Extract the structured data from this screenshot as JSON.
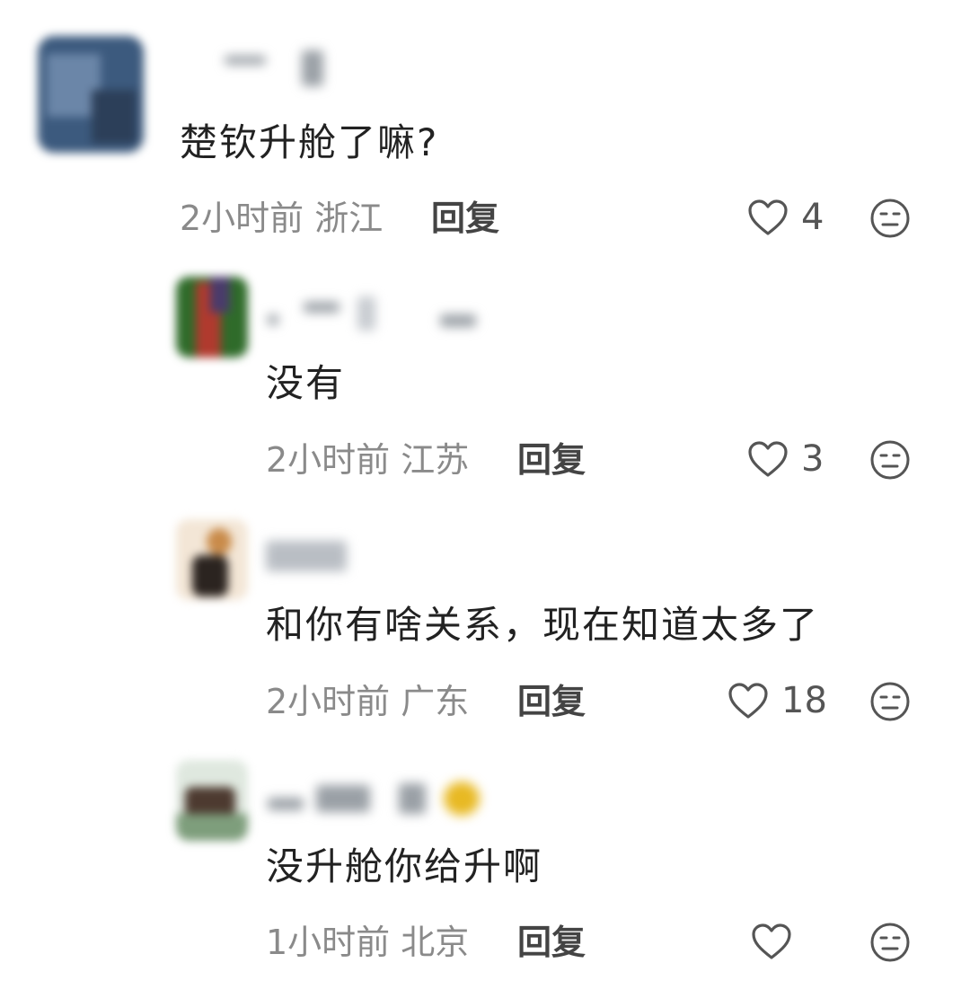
{
  "comments": [
    {
      "text": "楚钦升舱了嘛?",
      "time": "2小时前",
      "location": "浙江",
      "reply_label": "回复",
      "likes": "4",
      "avatar_colors": [
        "#3c5a7e",
        "#6b86a8",
        "#2c3f59"
      ]
    },
    {
      "text": "没有",
      "time": "2小时前",
      "location": "江苏",
      "reply_label": "回复",
      "likes": "3",
      "avatar_colors": [
        "#2f6b2a",
        "#b03a2e",
        "#4a3b6b"
      ]
    },
    {
      "text": "和你有啥关系，现在知道太多了",
      "time": "2小时前",
      "location": "广东",
      "reply_label": "回复",
      "likes": "18",
      "avatar_colors": [
        "#f3e6d6",
        "#2b2420",
        "#c98b4a"
      ]
    },
    {
      "text": "没升舱你给升啊",
      "time": "1小时前",
      "location": "北京",
      "reply_label": "回复",
      "likes": "",
      "avatar_colors": [
        "#dfe8df",
        "#4d3a30",
        "#7e9e7c"
      ]
    }
  ]
}
